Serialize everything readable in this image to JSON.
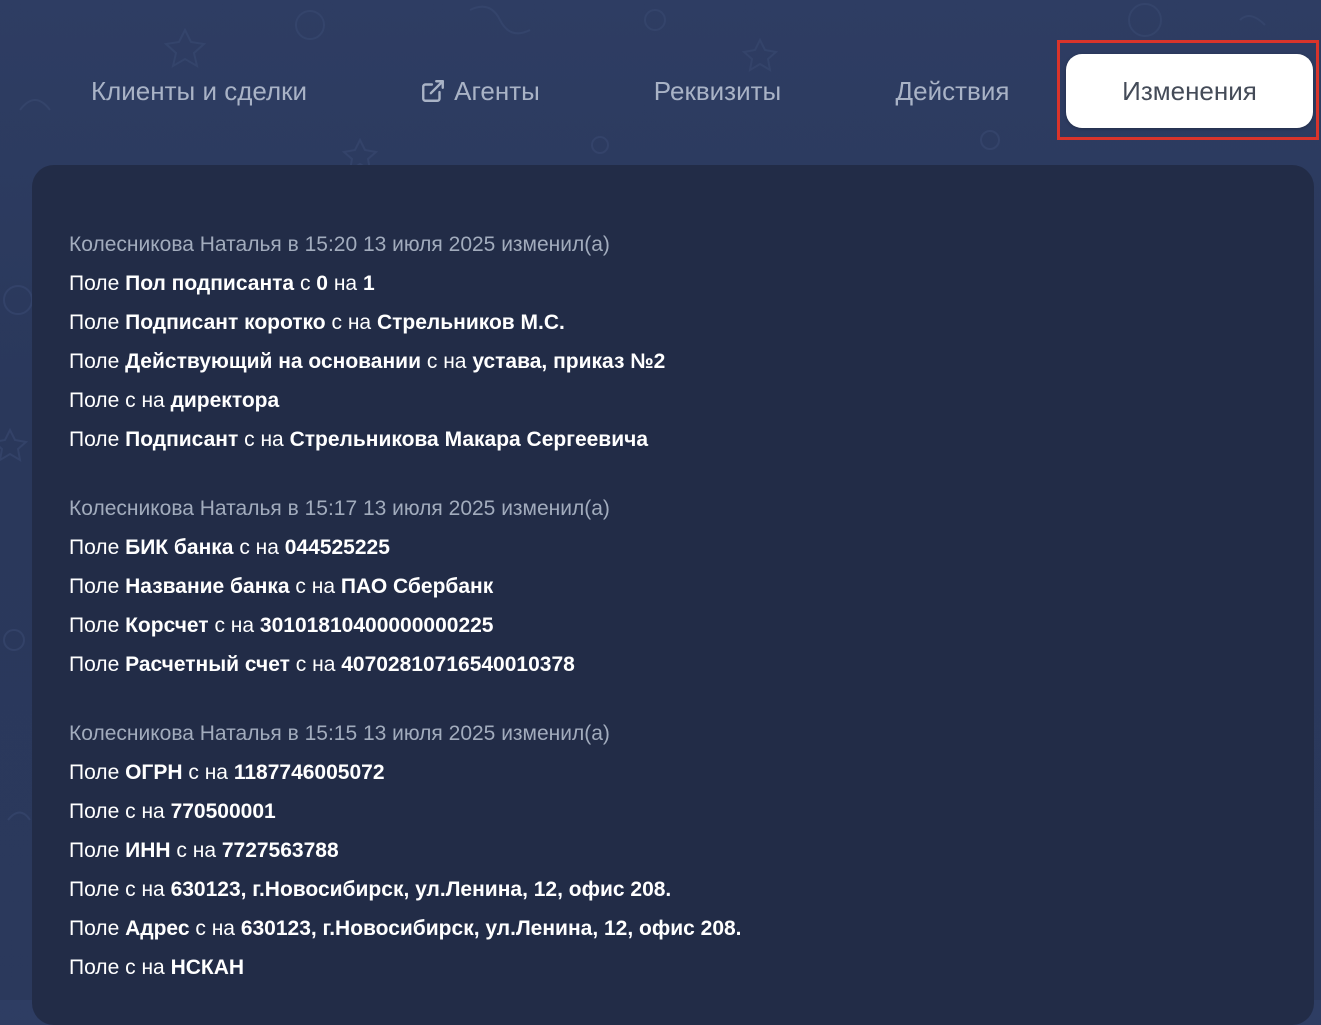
{
  "tabs": [
    {
      "label": "Клиенты и сделки",
      "active": false
    },
    {
      "label": "Агенты",
      "active": false,
      "icon": "external-link-icon"
    },
    {
      "label": "Реквизиты",
      "active": false
    },
    {
      "label": "Действия",
      "active": false
    },
    {
      "label": "Изменения",
      "active": true
    }
  ],
  "colors": {
    "background": "#2b395c",
    "panel": "#222c47",
    "active_tab": "#ffffff",
    "highlight": "#d9342b",
    "muted_text": "#a2acbd"
  },
  "log": {
    "word_field": "Поле",
    "word_from": "с",
    "word_to": "на",
    "entries": [
      {
        "header": "Колесникова Наталья в 15:20 13 июля 2025 изменил(а)",
        "changes": [
          {
            "field": "Пол подписанта",
            "from": "0",
            "to": "1"
          },
          {
            "field": "Подписант коротко",
            "from": "",
            "to": "Стрельников М.С."
          },
          {
            "field": "Действующий на основании",
            "from": "",
            "to": "устава, приказ №2"
          },
          {
            "field": "",
            "from": "",
            "to": "директора"
          },
          {
            "field": "Подписант",
            "from": "",
            "to": "Стрельникова Макара Сергеевича"
          }
        ]
      },
      {
        "header": "Колесникова Наталья в 15:17 13 июля 2025 изменил(а)",
        "changes": [
          {
            "field": "БИК банка",
            "from": "",
            "to": "044525225"
          },
          {
            "field": "Название банка",
            "from": "",
            "to": "ПАО Сбербанк"
          },
          {
            "field": "Корсчет",
            "from": "",
            "to": "30101810400000000225"
          },
          {
            "field": "Расчетный счет",
            "from": "",
            "to": "40702810716540010378"
          }
        ]
      },
      {
        "header": "Колесникова Наталья в 15:15 13 июля 2025 изменил(а)",
        "changes": [
          {
            "field": "ОГРН",
            "from": "",
            "to": "1187746005072"
          },
          {
            "field": "",
            "from": "",
            "to": "770500001"
          },
          {
            "field": "ИНН",
            "from": "",
            "to": "7727563788"
          },
          {
            "field": "",
            "from": "",
            "to": "630123, г.Новосибирск, ул.Ленина, 12, офис 208."
          },
          {
            "field": "Адрес",
            "from": "",
            "to": "630123, г.Новосибирск, ул.Ленина, 12, офис 208."
          },
          {
            "field": "",
            "from": "",
            "to": "НСКАН"
          }
        ]
      }
    ]
  }
}
